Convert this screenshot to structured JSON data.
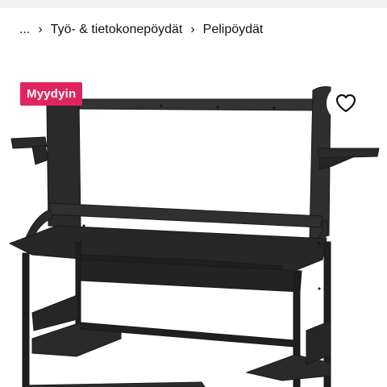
{
  "breadcrumb": {
    "ellipsis": "...",
    "items": [
      {
        "label": "Työ- & tietokonepöydät"
      },
      {
        "label": "Pelipöydät"
      }
    ]
  },
  "product": {
    "badge": "Myydyin",
    "image_icon": "gaming-desk-photo",
    "favorite_icon": "heart-outline-icon"
  },
  "colors": {
    "badge_bg": "#e0245e",
    "desk": "#2b2b2b"
  }
}
